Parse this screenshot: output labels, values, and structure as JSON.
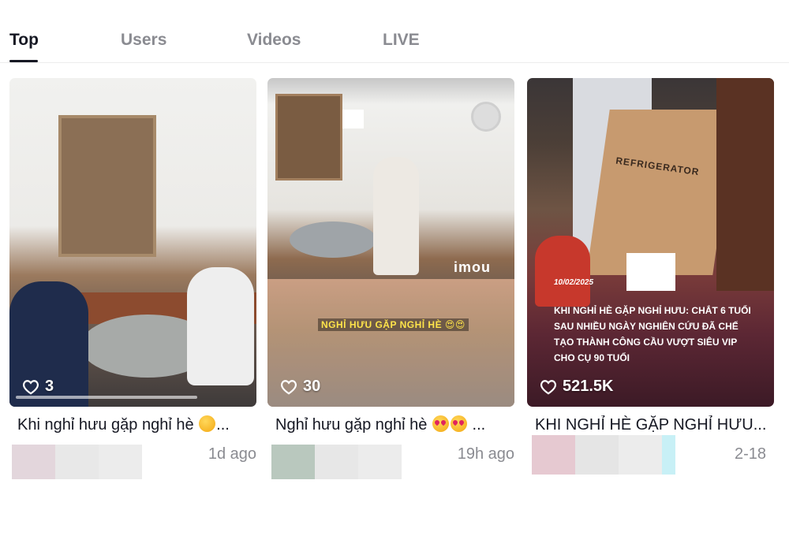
{
  "tabs": [
    {
      "label": "Top",
      "active": true
    },
    {
      "label": "Users",
      "active": false
    },
    {
      "label": "Videos",
      "active": false
    },
    {
      "label": "LIVE",
      "active": false
    }
  ],
  "cards": [
    {
      "likes": "3",
      "caption": "Khi nghỉ hưu gặp nghỉ hè",
      "caption_ellipsis": "...",
      "emoji": [
        "smile-emoji"
      ],
      "date": "1d ago",
      "overlay_text": "",
      "blur_colors": [
        "#e3d6dc",
        "#e8e8e8",
        "#ececec"
      ]
    },
    {
      "likes": "30",
      "caption": "Nghỉ hưu gặp nghỉ hè",
      "caption_ellipsis": "...",
      "emoji": [
        "heart-eyes-emoji",
        "heart-eyes-emoji"
      ],
      "date": "19h ago",
      "overlay_text": "NGHỈ HƯU GẶP NGHỈ HÈ 😍😍",
      "watermark": "imou",
      "blur_colors": [
        "#b9c8be",
        "#e7e7e7",
        "#ececec"
      ]
    },
    {
      "likes": "521.5K",
      "caption": "KHI NGHỈ HÈ GẶP NGHỈ HƯU...",
      "caption_ellipsis": "",
      "emoji": [],
      "date": "2-18",
      "overlay_date": "10/02/2025",
      "overlay_text": "KHI NGHỈ HÈ GẶP NGHỈ HƯU: CHẮT 6 TUỔI SAU NHIỀU NGÀY NGHIÊN CỨU ĐÃ CHẾ TẠO THÀNH CÔNG CẦU VƯỢT SIÊU VIP CHO CỤ 90 TUỔI",
      "box_label": "REFRIGERATOR",
      "blur_colors": [
        "#e6c9d1",
        "#e5e5e5",
        "#ececec",
        "#c8f0f6"
      ]
    }
  ],
  "colors": {
    "active_tab": "#161823",
    "inactive_tab": "#8a8b91",
    "date_text": "#8a8b91"
  }
}
